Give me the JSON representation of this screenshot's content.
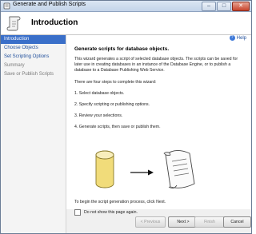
{
  "window": {
    "title": "Generate and Publish Scripts"
  },
  "header": {
    "title": "Introduction"
  },
  "sidebar": {
    "items": [
      {
        "label": "Introduction",
        "state": "active"
      },
      {
        "label": "Choose Objects",
        "state": "link"
      },
      {
        "label": "Set Scripting Options",
        "state": "link"
      },
      {
        "label": "Summary",
        "state": "disabled"
      },
      {
        "label": "Save or Publish Scripts",
        "state": "disabled"
      }
    ]
  },
  "content": {
    "help_label": "Help",
    "title": "Generate scripts for database objects.",
    "paragraph1": "This wizard generates a script of selected database objects. The scripts can be saved for later use in creating databases in an instance of the Database Engine, or to publish a database to a Database Publishing Web Service.",
    "steps_intro": "There are four steps to complete this wizard:",
    "steps": [
      "1. Select database objects.",
      "2. Specify scripting or publishing options.",
      "3. Review your selections.",
      "4. Generate scripts, then save or publish them."
    ],
    "begin_text": "To begin the script generation process, click Next.",
    "checkbox_label": "Do not show this page again."
  },
  "buttons": {
    "previous": "< Previous",
    "next": "Next >",
    "finish": "Finish",
    "cancel": "Cancel"
  },
  "icons": [
    "scroll-icon",
    "help-icon",
    "database-cylinder-icon",
    "arrow-right-icon",
    "script-scroll-icon"
  ],
  "colors": {
    "accent": "#3a6fc9",
    "link": "#1f4e9b"
  }
}
